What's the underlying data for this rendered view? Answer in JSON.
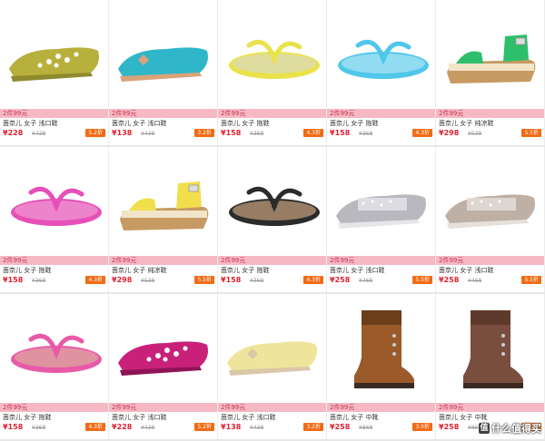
{
  "products": [
    {
      "promo": "2件99元",
      "name": "茵奈儿 女子 浅口鞋",
      "price": "¥228",
      "old_price": "¥438",
      "discount": "5.2折",
      "image": "flat-perforated-yellow",
      "colors": {
        "main": "#b8b03c",
        "accent": "#8f8a2e"
      }
    },
    {
      "promo": "2件99元",
      "name": "茵奈儿 女子 浅口鞋",
      "price": "¥138",
      "old_price": "¥438",
      "discount": "3.2折",
      "image": "flat-bow-turquoise",
      "colors": {
        "main": "#2fb7c9",
        "accent": "#d9a37a"
      }
    },
    {
      "promo": "2件99元",
      "name": "茵奈儿 女子 拖鞋",
      "price": "¥158",
      "old_price": "¥368",
      "discount": "4.3折",
      "image": "flipflop-yellow",
      "colors": {
        "main": "#e9e24a",
        "accent": "#d9d9d9"
      }
    },
    {
      "promo": "2件99元",
      "name": "茵奈儿 女子 拖鞋",
      "price": "¥158",
      "old_price": "¥368",
      "discount": "4.3折",
      "image": "flipflop-aqua",
      "colors": {
        "main": "#4fc7e8",
        "accent": "#bfe9f7"
      }
    },
    {
      "promo": "2件99元",
      "name": "茵奈儿 女子 纯凉鞋",
      "price": "¥298",
      "old_price": "¥538",
      "discount": "5.5折",
      "image": "sandal-green",
      "colors": {
        "main": "#2fbf6b",
        "accent": "#c79a63"
      }
    },
    {
      "promo": "2件99元",
      "name": "茵奈儿 女子 拖鞋",
      "price": "¥158",
      "old_price": "¥368",
      "discount": "4.3折",
      "image": "flipflop-pink",
      "colors": {
        "main": "#e64fb8",
        "accent": "#f2a6d6"
      }
    },
    {
      "promo": "2件99元",
      "name": "茵奈儿 女子 纯凉鞋",
      "price": "¥298",
      "old_price": "¥538",
      "discount": "5.5折",
      "image": "sandal-yellow",
      "colors": {
        "main": "#f0df4a",
        "accent": "#c79a63"
      }
    },
    {
      "promo": "2件99元",
      "name": "茵奈儿 女子 拖鞋",
      "price": "¥158",
      "old_price": "¥368",
      "discount": "4.3折",
      "image": "flipflop-black",
      "colors": {
        "main": "#2b2b2b",
        "accent": "#e0b48a"
      }
    },
    {
      "promo": "2件99元",
      "name": "茵奈儿 女子 浅口鞋",
      "price": "¥258",
      "old_price": "¥468",
      "discount": "5.5折",
      "image": "flat-rhinestone-silver",
      "colors": {
        "main": "#b8b8bf",
        "accent": "#e6e6ea"
      }
    },
    {
      "promo": "2件99元",
      "name": "茵奈儿 女子 浅口鞋",
      "price": "¥258",
      "old_price": "¥468",
      "discount": "5.5折",
      "image": "flat-rhinestone-taupe",
      "colors": {
        "main": "#bfb0a6",
        "accent": "#e6e0db"
      }
    },
    {
      "promo": "2件99元",
      "name": "茵奈儿 女子 拖鞋",
      "price": "¥158",
      "old_price": "¥368",
      "discount": "4.3折",
      "image": "flipflop-leopard-pink",
      "colors": {
        "main": "#e85aa8",
        "accent": "#d9b79a"
      }
    },
    {
      "promo": "2件99元",
      "name": "茵奈儿 女子 浅口鞋",
      "price": "¥228",
      "old_price": "¥438",
      "discount": "5.2折",
      "image": "flat-perforated-magenta",
      "colors": {
        "main": "#c9217a",
        "accent": "#8e1456"
      }
    },
    {
      "promo": "2件99元",
      "name": "茵奈儿 女子 浅口鞋",
      "price": "¥138",
      "old_price": "¥438",
      "discount": "3.2折",
      "image": "flat-bow-cream",
      "colors": {
        "main": "#efe59a",
        "accent": "#d9c7a8"
      }
    },
    {
      "promo": "2件99元",
      "name": "茵奈儿 女子 中靴",
      "price": "¥258",
      "old_price": "¥868",
      "discount": "3.0折",
      "image": "boot-brown-leather",
      "colors": {
        "main": "#9a5a2a",
        "accent": "#6e3d1a"
      }
    },
    {
      "promo": "2件99元",
      "name": "茵奈儿 女子 中靴",
      "price": "¥258",
      "old_price": "¥868",
      "discount": "3.0折",
      "image": "boot-fringe-brown",
      "colors": {
        "main": "#7a4e3e",
        "accent": "#5e3a2c"
      }
    }
  ],
  "watermark": {
    "icon": "值",
    "text": "什么值得买"
  }
}
